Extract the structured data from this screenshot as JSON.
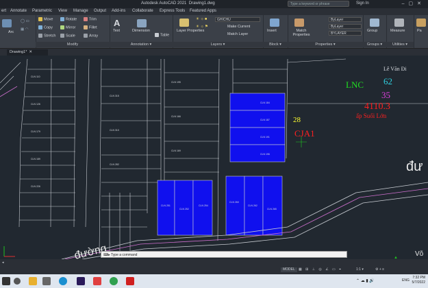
{
  "app": {
    "title": "Autodesk AutoCAD 2021",
    "document": "Drawing1.dwg",
    "search_placeholder": "Type a keyword or phrase",
    "signin": "Sign In"
  },
  "menu_tabs": [
    "ert",
    "Annotate",
    "Parametric",
    "View",
    "Manage",
    "Output",
    "Add-ins",
    "Collaborate",
    "Express Tools",
    "Featured Apps"
  ],
  "ribbon": {
    "draw": {
      "arc_label": "Arc"
    },
    "modify": {
      "label": "Modify",
      "items": [
        "Move",
        "Rotate",
        "Trim",
        "Copy",
        "Mirror",
        "Fillet",
        "Stretch",
        "Scale",
        "Array"
      ]
    },
    "annotation": {
      "label": "Annotation",
      "text": "Text",
      "dimension": "Dimension",
      "table": "Table"
    },
    "layers": {
      "label": "Layers",
      "layer_properties": "Layer Properties",
      "current_layer": "GHICHU",
      "make_current": "Make Current",
      "match_layer": "Match Layer"
    },
    "block": {
      "label": "Block",
      "insert": "Insert"
    },
    "properties": {
      "label": "Properties",
      "match": "Match Properties",
      "color": "ByLayer",
      "linetype": "ByLayer",
      "lineweight": "BYLAYER"
    },
    "groups": {
      "label": "Groups",
      "group": "Group"
    },
    "utilities": {
      "label": "Utilities",
      "measure": "Measure"
    },
    "clipboard": {
      "paste": "Pa"
    }
  },
  "doc_tab": "Drawing1*",
  "canvas": {
    "red_texts": {
      "name": "Lê Văn Đi",
      "lnc": "LNC",
      "area": "4110.3",
      "place": "ấp Suối Lớn",
      "cja": "CJA1"
    },
    "colored_numbers": {
      "green": "62",
      "magenta": "35",
      "yellow": "28"
    },
    "road_text_right": "đư",
    "road_text_left": "đường",
    "bottom_right_text": "Võ"
  },
  "command_prompt": "Type a command",
  "status": {
    "model": "MODEL",
    "scale": "1:1"
  },
  "taskbar": {
    "time": "7:32 PM",
    "date": "5/7/2022",
    "lang": "ENG"
  }
}
